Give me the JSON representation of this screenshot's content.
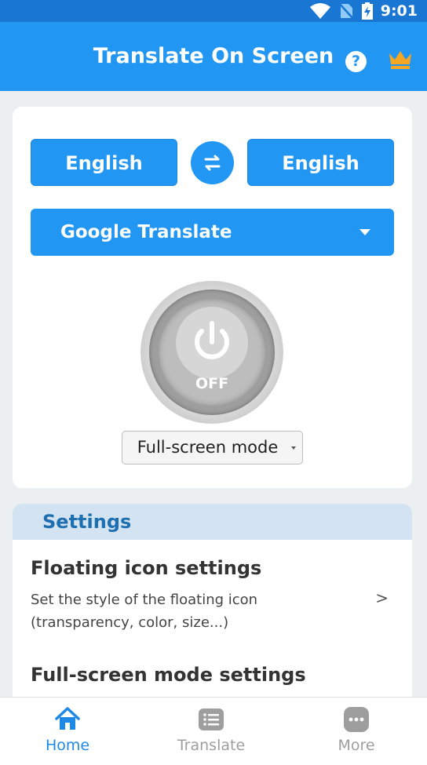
{
  "status_bar": {
    "time": "9:01",
    "icons": [
      "wifi-icon",
      "no-sim-icon",
      "battery-charging-icon"
    ]
  },
  "app_bar": {
    "title": "Translate On Screen",
    "help_icon": "?",
    "crown_icon": "crown-icon"
  },
  "translator": {
    "source_language": "English",
    "target_language": "English",
    "swap_icon": "swap-arrows-icon",
    "engine": "Google Translate",
    "power_state": "OFF",
    "mode": "Full-screen mode"
  },
  "settings": {
    "header": "Settings",
    "items": [
      {
        "title": "Floating icon settings",
        "description": "Set the style of the floating icon (transparency, color, size...)",
        "chevron": ">"
      },
      {
        "title": "Full-screen mode settings"
      }
    ]
  },
  "bottom_nav": {
    "items": [
      {
        "label": "Home",
        "icon": "home-icon",
        "active": true
      },
      {
        "label": "Translate",
        "icon": "translate-list-icon",
        "active": false
      },
      {
        "label": "More",
        "icon": "more-dots-icon",
        "active": false
      }
    ]
  },
  "colors": {
    "primary": "#2196f3",
    "status_bar": "#1976d2",
    "crown": "#f5a623",
    "settings_header_bg": "#d3e3f1",
    "settings_header_text": "#1e6fb0",
    "nav_active": "#1e88e5",
    "nav_inactive": "#9e9e9e"
  }
}
